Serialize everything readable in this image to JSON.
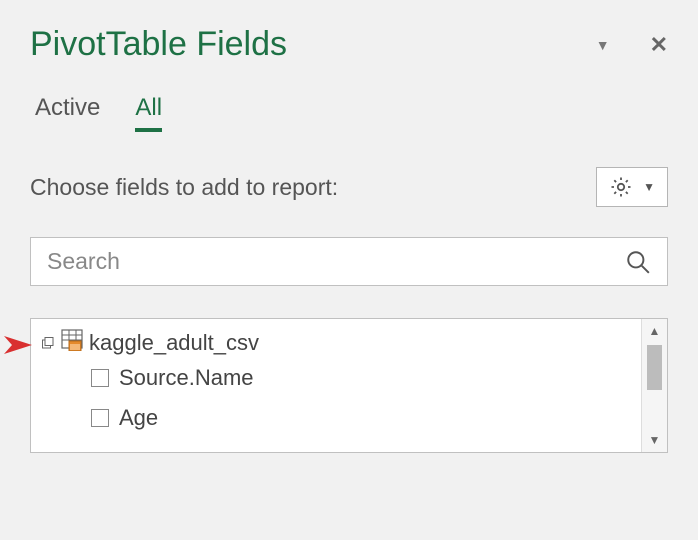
{
  "header": {
    "title": "PivotTable Fields"
  },
  "tabs": {
    "active_label": "Active",
    "all_label": "All"
  },
  "choose_label": "Choose fields to add to report:",
  "search": {
    "placeholder": "Search"
  },
  "tree": {
    "table_name": "kaggle_adult_csv",
    "fields": [
      {
        "label": "Source.Name"
      },
      {
        "label": "Age"
      }
    ]
  }
}
